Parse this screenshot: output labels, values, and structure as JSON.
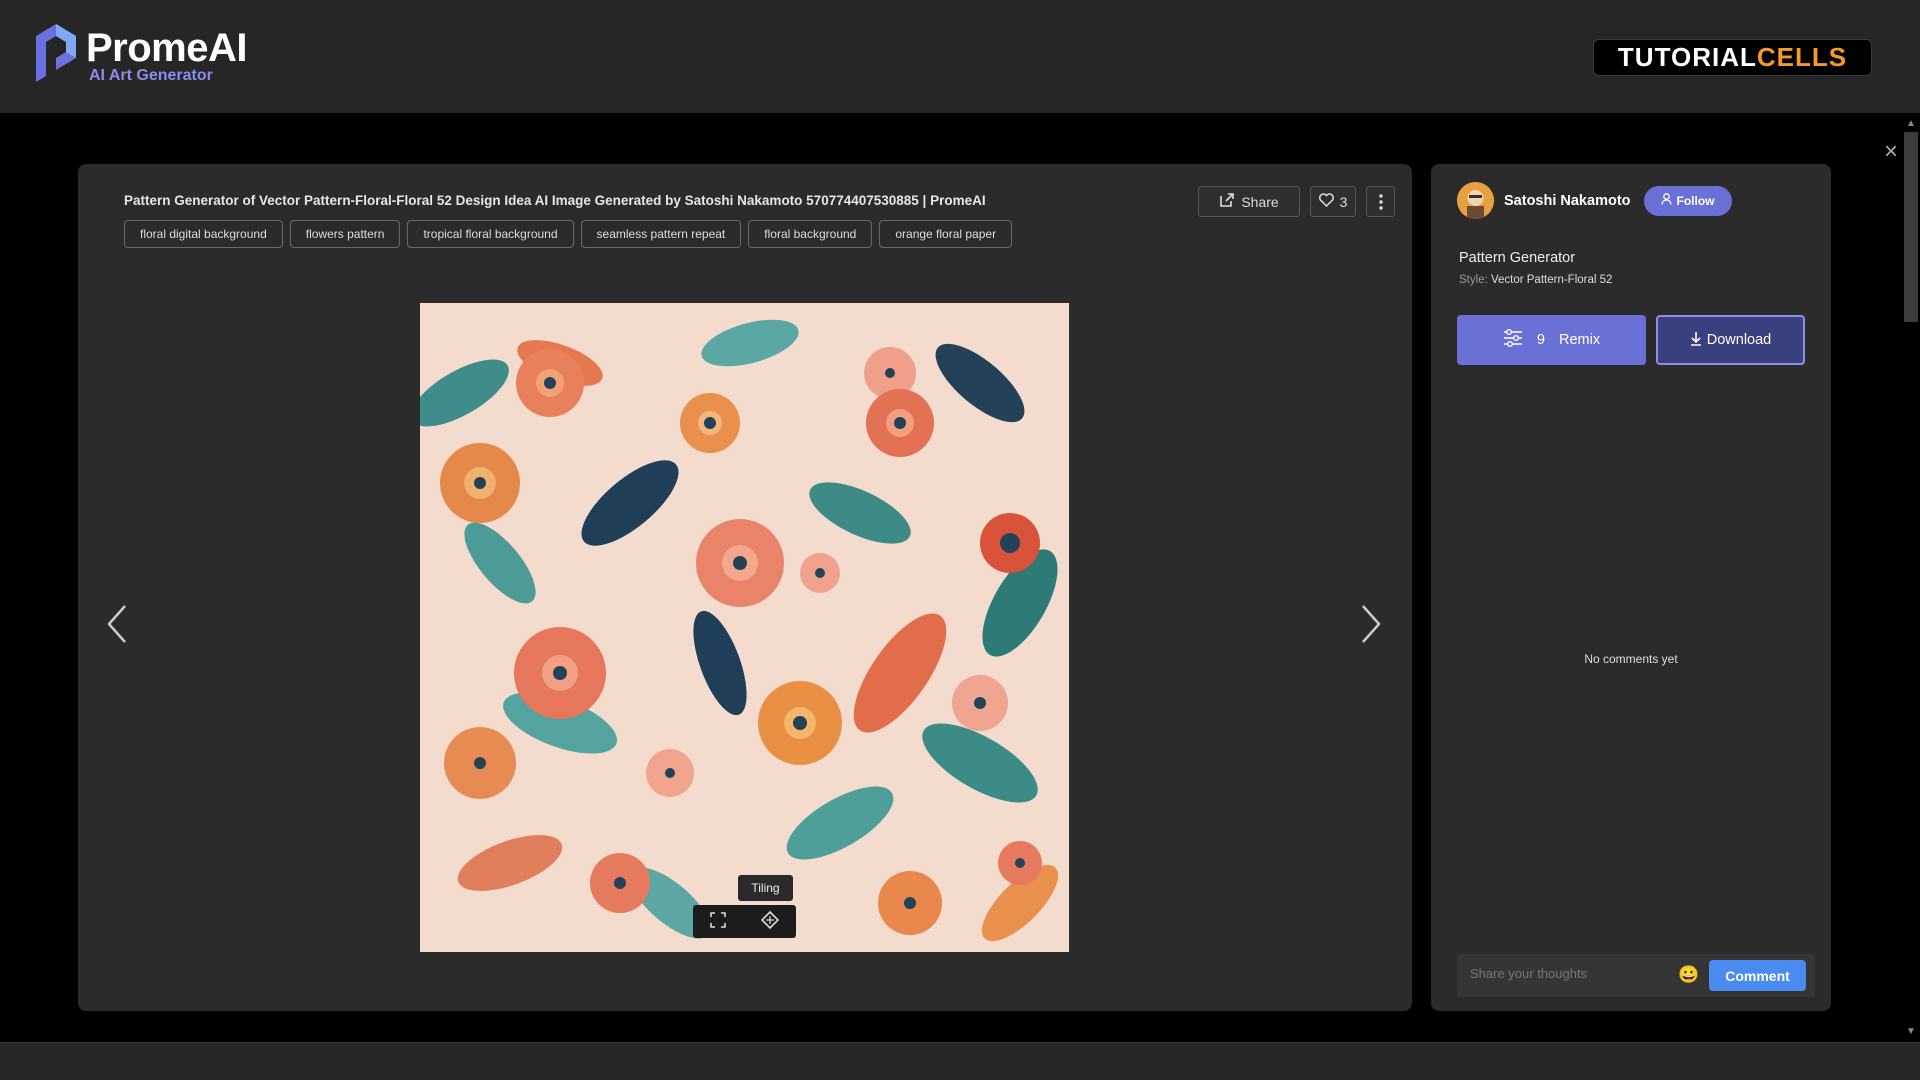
{
  "header": {
    "logo_name": "PromeAI",
    "logo_sub": "AI Art Generator",
    "badge_part1": "TUTORIAL",
    "badge_part2": "CELLS"
  },
  "modal": {
    "close_label": "×",
    "title": "Pattern Generator of Vector Pattern-Floral-Floral 52 Design Idea AI Image Generated by Satoshi Nakamoto 570774407530885 | PromeAI",
    "tags": [
      "floral digital background",
      "flowers pattern",
      "tropical floral background",
      "seamless pattern repeat",
      "floral background",
      "orange floral paper"
    ],
    "share_label": "Share",
    "like_count": "3",
    "tooltip": "Tiling"
  },
  "side": {
    "author": "Satoshi Nakamoto",
    "follow_label": "Follow",
    "generator": "Pattern Generator",
    "style_key": "Style:",
    "style_value": "Vector Pattern-Floral 52",
    "remix_count": "9",
    "remix_label": "Remix",
    "download_label": "Download",
    "no_comments": "No comments yet",
    "comment_placeholder": "Share your thoughts",
    "comment_button": "Comment"
  },
  "colors": {
    "accent": "#6b70d6",
    "comment_button": "#4a8bf0",
    "badge_orange": "#f39a2a"
  }
}
